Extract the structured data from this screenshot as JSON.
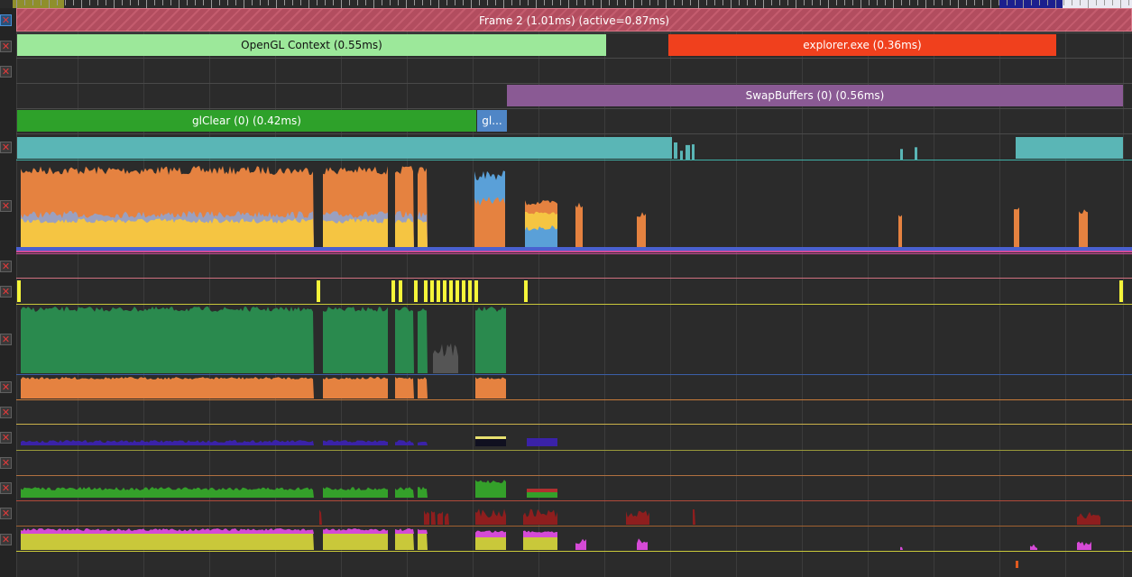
{
  "timeline": {
    "frame_label": "Frame 2 (1.01ms) (active=0.87ms)",
    "context_label": "OpenGL Context (0.55ms)",
    "process_label": "explorer.exe (0.36ms)",
    "swap_label": "SwapBuffers (0) (0.56ms)",
    "clear_label": "glClear (0) (0.42ms)",
    "short_call_label": "gl..."
  },
  "colors": {
    "frame": "#b24d5f",
    "context": "#9ce89a",
    "process": "#f0401d",
    "swap": "#8a5a94",
    "clear": "#2ea12a",
    "short_call": "#4f86c6",
    "teal": "#5ab6b6",
    "orange": "#e58240",
    "yellow": "#f5c542",
    "dark_green": "#2a8a4e",
    "purple_track": "#3a22a8",
    "bright_green": "#34a02a",
    "maroon": "#8e1e1e",
    "lime": "#c9c83a",
    "magenta": "#d54ad6"
  },
  "icons": {
    "close": "close-icon"
  }
}
